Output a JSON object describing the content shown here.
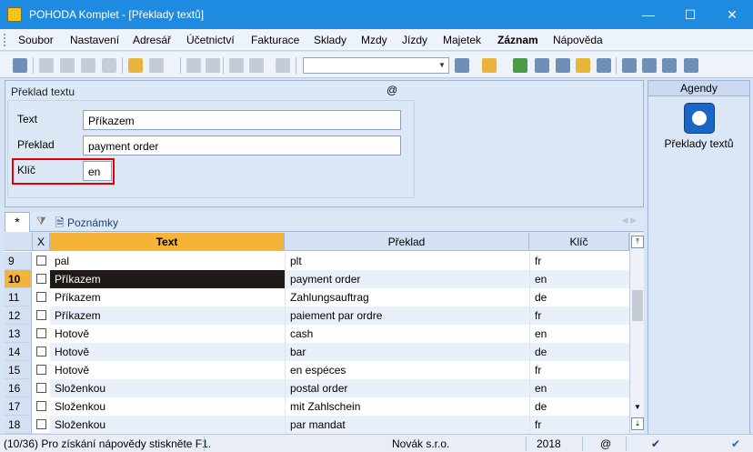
{
  "window": {
    "title": "POHODA Komplet - [Překlady textů]",
    "min": "—",
    "max": "☐",
    "close": "✕"
  },
  "menu": [
    "Soubor",
    "Nastavení",
    "Adresář",
    "Účetnictví",
    "Fakturace",
    "Sklady",
    "Mzdy",
    "Jízdy",
    "Majetek",
    "Záznam",
    "Nápověda"
  ],
  "form": {
    "caption": "Překlad textu",
    "at": "@",
    "text_label": "Text",
    "text_value": "Příkazem",
    "preklad_label": "Překlad",
    "preklad_value": "payment order",
    "klic_label": "Klíč",
    "klic_value": "en"
  },
  "agendy": {
    "title": "Agendy",
    "item": "Překlady textů"
  },
  "tabs": {
    "star": "*",
    "notes": "Poznámky"
  },
  "grid": {
    "headers": {
      "x": "X",
      "text": "Text",
      "preklad": "Překlad",
      "klic": "Klíč"
    },
    "rows": [
      {
        "num": "9",
        "text": "pal",
        "preklad": "plt",
        "klic": "fr"
      },
      {
        "num": "10",
        "text": "Příkazem",
        "preklad": "payment order",
        "klic": "en"
      },
      {
        "num": "11",
        "text": "Příkazem",
        "preklad": "Zahlungsauftrag",
        "klic": "de"
      },
      {
        "num": "12",
        "text": "Příkazem",
        "preklad": "paiement par ordre",
        "klic": "fr"
      },
      {
        "num": "13",
        "text": "Hotově",
        "preklad": "cash",
        "klic": "en"
      },
      {
        "num": "14",
        "text": "Hotově",
        "preklad": "bar",
        "klic": "de"
      },
      {
        "num": "15",
        "text": "Hotově",
        "preklad": "en espéces",
        "klic": "fr"
      },
      {
        "num": "16",
        "text": "Složenkou",
        "preklad": "postal order",
        "klic": "en"
      },
      {
        "num": "17",
        "text": "Složenkou",
        "preklad": "mit Zahlschein",
        "klic": "de"
      },
      {
        "num": "18",
        "text": "Složenkou",
        "preklad": "par mandat",
        "klic": "fr"
      }
    ]
  },
  "status": {
    "help": "(10/36) Pro získání nápovědy stiskněte F1.",
    "company": "Novák s.r.o.",
    "year": "2018",
    "at": "@"
  },
  "colors": {
    "titlebar": "#1e8be0",
    "sorted_header": "#f5b338",
    "selected_row": "#1f1a16",
    "highlight_box": "#e00000"
  }
}
